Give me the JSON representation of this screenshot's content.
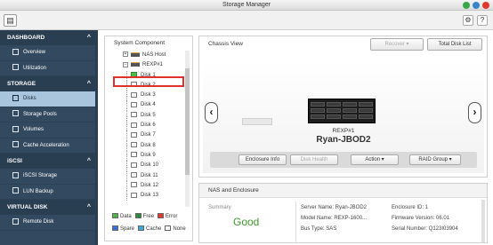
{
  "window": {
    "title": "Storage Manager",
    "controls": [
      {
        "name": "minimize",
        "color": "#3aa84a"
      },
      {
        "name": "maximize",
        "color": "#3a84c8"
      },
      {
        "name": "close",
        "color": "#e0392f"
      }
    ]
  },
  "toolbar": {
    "settings_glyph": "⚙",
    "help_glyph": "?",
    "menu_glyph": "▤"
  },
  "sidebar": {
    "sections": [
      {
        "label": "DASHBOARD",
        "items": [
          {
            "label": "Overview"
          },
          {
            "label": "Utilization"
          }
        ]
      },
      {
        "label": "STORAGE",
        "items": [
          {
            "label": "Disks",
            "active": true
          },
          {
            "label": "Storage Pools"
          },
          {
            "label": "Volumes"
          },
          {
            "label": "Cache Acceleration"
          }
        ]
      },
      {
        "label": "iSCSI",
        "items": [
          {
            "label": "iSCSI Storage"
          },
          {
            "label": "LUN Backup"
          }
        ]
      },
      {
        "label": "VIRTUAL DISK",
        "items": [
          {
            "label": "Remote Disk"
          }
        ]
      }
    ]
  },
  "system_component": {
    "title": "System Component",
    "host": "NAS Host",
    "expansion": "REXP#1",
    "disks": [
      "Disk 1",
      "Disk 2",
      "Disk 3",
      "Disk 4",
      "Disk 5",
      "Disk 6",
      "Disk 7",
      "Disk 8",
      "Disk 9",
      "Disk 10",
      "Disk 11",
      "Disk 12",
      "Disk 13"
    ],
    "legend": [
      {
        "label": "Data",
        "color": "#4db848"
      },
      {
        "label": "Free",
        "color": "#2e8b3a"
      },
      {
        "label": "Error",
        "color": "#e0392f"
      },
      {
        "label": "Spare",
        "color": "#3a6ed8"
      },
      {
        "label": "Cache",
        "color": "#3aa8d8"
      },
      {
        "label": "None",
        "color": "#ffffff"
      }
    ]
  },
  "chassis": {
    "title": "Chassis View",
    "recover_label": "Recover",
    "total_disk_list_label": "Total Disk List",
    "device_id": "REXP#1",
    "device_name": "Ryan-JBOD2",
    "actions": {
      "enclosure_info": "Enclosure Info",
      "disk_health": "Disk Health",
      "action": "Action",
      "raid_group": "RAID Group"
    }
  },
  "nas_enclosure": {
    "title": "NAS and Enclosure",
    "summary_label": "Summary",
    "status": "Good",
    "server_name": "Server Name: Ryan-JBOD2",
    "model_name": "Model Name: REXP-1600...",
    "bus_type": "Bus Type: SAS",
    "enclosure_id": "Enclosure ID: 1",
    "firmware": "Firmware Version: 06.01",
    "serial": "Serial Number: Q123I03904"
  }
}
